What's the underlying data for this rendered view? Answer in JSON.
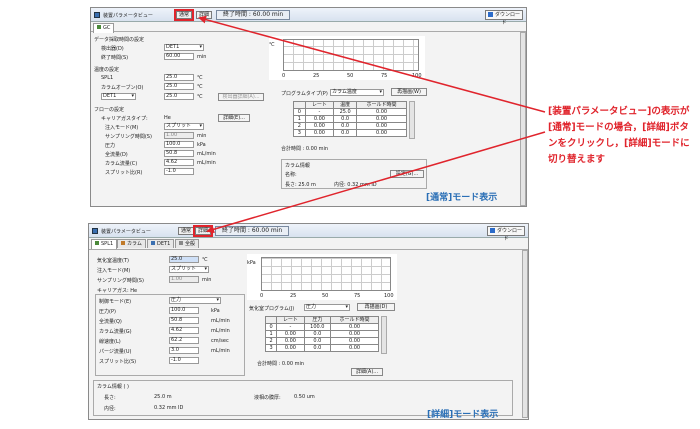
{
  "top": {
    "title": "装置パラメータビュー",
    "btn_normal": "通常",
    "btn_detail": "詳細",
    "end_time": "終了時間 : 60.00 min",
    "download": "ダウンロード",
    "tab_gc": "GC",
    "sec_data": "データ採取時間の設定",
    "detector_label": "検出器(D)",
    "detector_value": "DET1",
    "endtime_label": "終了時間(S)",
    "endtime_value": "60.00",
    "endtime_unit": "min",
    "sec_temp": "温度の設定",
    "spl1_label": "SPL1",
    "spl1_value": "25.0",
    "spl1_unit": "℃",
    "oven_label": "カラムオーブン(O)",
    "oven_value": "25.0",
    "oven_unit": "℃",
    "det1_sel": "DET1",
    "det1_value": "25.0",
    "det1_unit": "℃",
    "detector_settings_btn": "検出器詳細(A)...",
    "sec_flow": "フローの設定",
    "carrier_label": "キャリアガスタイプ:",
    "carrier_value": "He",
    "detail_btn": "詳細(E)...",
    "inj_mode_label": "注入モード(M)",
    "inj_mode_value": "スプリット",
    "sampling_label": "サンプリング時間(S)",
    "sampling_value": "1.00",
    "sampling_unit": "min",
    "pressure_label": "圧力",
    "pressure_value": "100.0",
    "pressure_unit": "kPa",
    "total_flow_label": "全流量(D)",
    "total_flow_value": "50.8",
    "total_flow_unit": "mL/min",
    "col_flow_label": "カラム流量(C)",
    "col_flow_value": "4.62",
    "col_flow_unit": "mL/min",
    "split_label": "スプリット比(R)",
    "split_value": "-1.0",
    "axis_c": "℃",
    "xticks": [
      "0",
      "25",
      "50",
      "75",
      "100"
    ],
    "program_label": "プログラムタイプ(P)",
    "program_value": "カラム温度",
    "program_btn": "再描画(W)",
    "tbl_headers": [
      "",
      "レート",
      "温度",
      "ホールド時間"
    ],
    "tbl_rows": [
      [
        "0",
        "-",
        "25.0",
        "0.00"
      ],
      [
        "1",
        "0.00",
        "0.0",
        "0.00"
      ],
      [
        "2",
        "0.00",
        "0.0",
        "0.00"
      ],
      [
        "3",
        "0.00",
        "0.0",
        "0.00"
      ]
    ],
    "total_time": "合計時間 : 0.00 min",
    "colinfo_title": "カラム情報",
    "colinfo_name": "名称:",
    "colinfo_btn": "設定(G)...",
    "colinfo_len": "長さ: 25.0 m",
    "colinfo_id": "内径: 0.32 mm ID",
    "caption": "[通常]モード表示"
  },
  "annotation": "[装置パラメータビュー]の表示が[通常]モードの場合，[詳細]ボタンをクリックし，[詳細]モードに切り替えます",
  "bottom": {
    "title": "装置パラメータビュー",
    "btn_normal": "通常",
    "btn_detail": "詳細",
    "end_time": "終了時間 : 60.00 min",
    "download": "ダウンロード",
    "tabs": [
      "SPL1",
      "カラム",
      "DET1",
      "全般"
    ],
    "vap_label": "気化室温度(T)",
    "vap_value": "25.0",
    "vap_unit": "℃",
    "inj_mode_label": "注入モード(M)",
    "inj_mode_value": "スプリット",
    "sampling_label": "サンプリング時間(S)",
    "sampling_value": "1.00",
    "sampling_unit": "min",
    "carrier_label": "キャリアガス: He",
    "control_label": "制御モード(E)",
    "control_value": "圧力",
    "pressure_label": "圧力(P)",
    "pressure_value": "100.0",
    "pressure_unit": "kPa",
    "total_flow_label": "全流量(Q)",
    "total_flow_value": "50.8",
    "total_flow_unit": "mL/min",
    "col_flow_label": "カラム流量(G)",
    "col_flow_value": "4.62",
    "col_flow_unit": "mL/min",
    "lin_vel_label": "線速度(L)",
    "lin_vel_value": "62.2",
    "lin_vel_unit": "cm/sec",
    "purge_label": "パージ流量(U)",
    "purge_value": "3.0",
    "purge_unit": "mL/min",
    "split_label": "スプリット比(S)",
    "split_value": "-1.0",
    "axis_kpa": "kPa",
    "xticks": [
      "0",
      "25",
      "50",
      "75",
      "100"
    ],
    "program_label": "気化室プログラム(J)",
    "program_value": "圧力",
    "program_btn": "再描画(D)",
    "tbl_headers": [
      "",
      "レート",
      "圧力",
      "ホールド時間"
    ],
    "tbl_rows": [
      [
        "0",
        "-",
        "100.0",
        "0.00"
      ],
      [
        "1",
        "0.00",
        "0.0",
        "0.00"
      ],
      [
        "2",
        "0.00",
        "0.0",
        "0.00"
      ],
      [
        "3",
        "0.00",
        "0.0",
        "0.00"
      ]
    ],
    "total_time": "合計時間 : 0.00 min",
    "detail_btn": "詳細(A)...",
    "colinfo_title": "カラム情報 ( )",
    "colinfo_len_label": "長さ:",
    "colinfo_len": "25.0 m",
    "colinfo_id_label": "内径:",
    "colinfo_id": "0.32 mm ID",
    "colinfo_film_label": "液相の膜厚:",
    "colinfo_film": "0.50 um",
    "caption": "[詳細]モード表示"
  },
  "colors": {
    "highlight": "#e0242c",
    "caption": "#2a6fb6"
  }
}
